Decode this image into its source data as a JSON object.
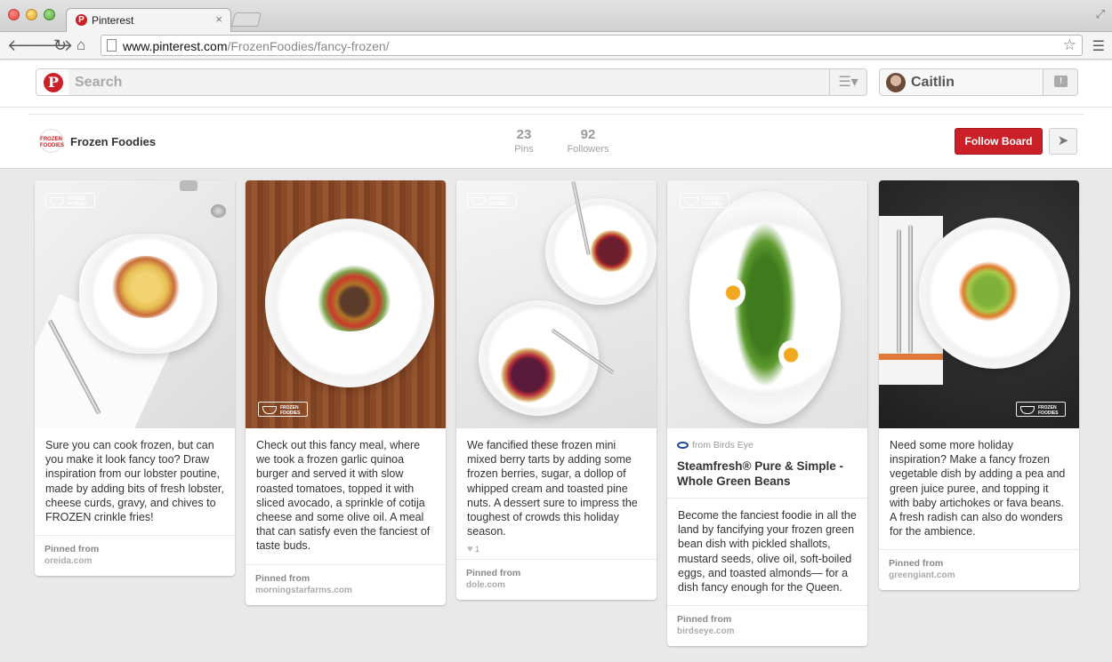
{
  "browser": {
    "tab_title": "Pinterest",
    "tab_close": "×",
    "url_host": "www.pinterest.com",
    "url_path": "/FrozenFoodies/fancy-frozen/"
  },
  "header": {
    "search_placeholder": "Search",
    "user_name": "Caitlin"
  },
  "board": {
    "name": "Frozen Foodies",
    "logo_text": "FROZEN FOODIES",
    "pins_count": "23",
    "pins_label": "Pins",
    "followers_count": "92",
    "followers_label": "Followers",
    "follow_button": "Follow Board"
  },
  "watermark_text": "FROZEN FOODIES",
  "pins": [
    {
      "description": "Sure you can cook frozen, but can you make it look fancy too? Draw inspiration from our lobster poutine, made by adding bits of fresh lobster, cheese curds, gravy, and chives to FROZEN crinkle fries!",
      "pinned_label": "Pinned from",
      "source": "oreida.com"
    },
    {
      "description": "Check out this fancy meal, where we took a frozen garlic quinoa burger and served it with slow roasted tomatoes, topped it with sliced avocado, a sprinkle of cotija cheese and some olive oil. A meal that can satisfy even the fanciest of taste buds.",
      "pinned_label": "Pinned from",
      "source": "morningstarfarms.com"
    },
    {
      "description": "We fancified these frozen mini mixed berry tarts by adding some frozen berries, sugar, a dollop of whipped cream and toasted pine nuts. A dessert sure to impress the toughest of crowds this holiday season.",
      "likes": "1",
      "pinned_label": "Pinned from",
      "source": "dole.com"
    },
    {
      "from": "from Birds Eye",
      "title": "Steamfresh® Pure & Simple - Whole Green Beans",
      "description": "Become the fanciest foodie in all the land by fancifying your frozen green bean dish with pickled shallots, mustard seeds, olive oil, soft-boiled eggs, and toasted almonds— for a dish fancy enough for the Queen.",
      "pinned_label": "Pinned from",
      "source": "birdseye.com"
    },
    {
      "description": "Need some more holiday inspiration? Make a fancy frozen vegetable dish by adding a pea and green juice puree, and topping it with baby artichokes or fava beans. A fresh radish can also do wonders for the ambience.",
      "pinned_label": "Pinned from",
      "source": "greengiant.com"
    }
  ]
}
